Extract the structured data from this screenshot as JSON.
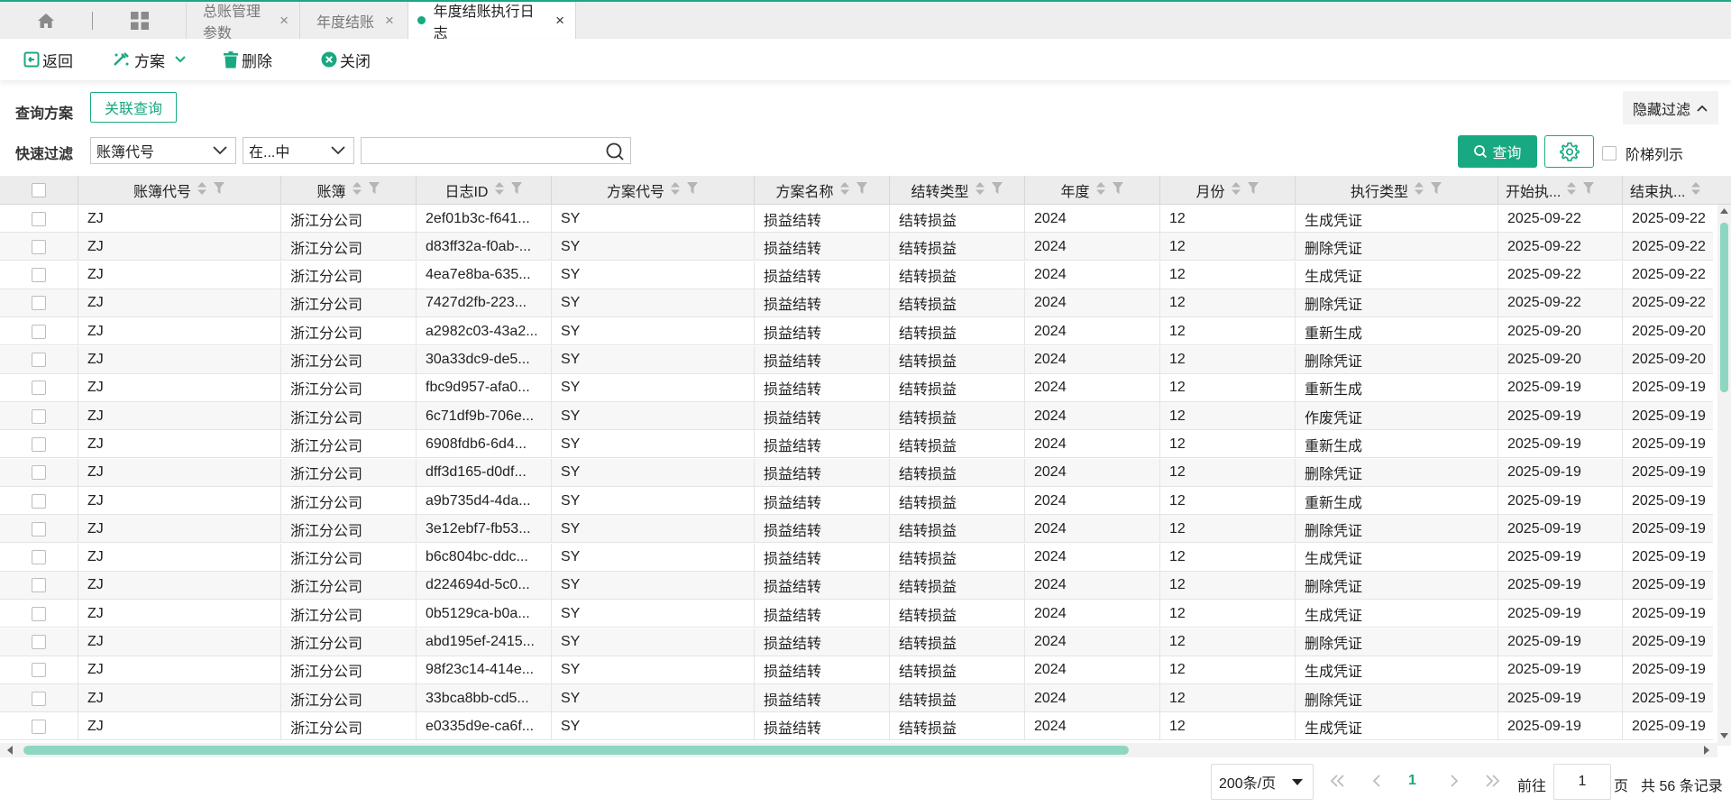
{
  "tabs": [
    {
      "label": "总账管理参数",
      "active": false
    },
    {
      "label": "年度结账",
      "active": false
    },
    {
      "label": "年度结账执行日志",
      "active": true
    }
  ],
  "toolbar": {
    "back_label": "返回",
    "scheme_label": "方案",
    "delete_label": "删除",
    "close_label": "关闭"
  },
  "filters": {
    "query_scheme_label": "查询方案",
    "assoc_query_label": "关联查询",
    "hide_filter_label": "隐藏过滤",
    "quick_filter_label": "快速过滤",
    "field_select": "账簿代号",
    "operator_select": "在...中",
    "search_value": "",
    "query_button": "查询",
    "ladder_label": "阶梯列示"
  },
  "colors": {
    "accent": "#18a982",
    "scroll_thumb": "#8fd6c2"
  },
  "table": {
    "columns": [
      "账簿代号",
      "账簿",
      "日志ID",
      "方案代号",
      "方案名称",
      "结转类型",
      "年度",
      "月份",
      "执行类型",
      "开始执...",
      "结束执..."
    ],
    "rows": [
      [
        "ZJ",
        "浙江分公司",
        "2ef01b3c-f641...",
        "SY",
        "损益结转",
        "结转损益",
        "2024",
        "12",
        "生成凭证",
        "2025-09-22",
        "2025-09-22"
      ],
      [
        "ZJ",
        "浙江分公司",
        "d83ff32a-f0ab-...",
        "SY",
        "损益结转",
        "结转损益",
        "2024",
        "12",
        "删除凭证",
        "2025-09-22",
        "2025-09-22"
      ],
      [
        "ZJ",
        "浙江分公司",
        "4ea7e8ba-635...",
        "SY",
        "损益结转",
        "结转损益",
        "2024",
        "12",
        "生成凭证",
        "2025-09-22",
        "2025-09-22"
      ],
      [
        "ZJ",
        "浙江分公司",
        "7427d2fb-223...",
        "SY",
        "损益结转",
        "结转损益",
        "2024",
        "12",
        "删除凭证",
        "2025-09-22",
        "2025-09-22"
      ],
      [
        "ZJ",
        "浙江分公司",
        "a2982c03-43a2...",
        "SY",
        "损益结转",
        "结转损益",
        "2024",
        "12",
        "重新生成",
        "2025-09-20",
        "2025-09-20"
      ],
      [
        "ZJ",
        "浙江分公司",
        "30a33dc9-de5...",
        "SY",
        "损益结转",
        "结转损益",
        "2024",
        "12",
        "删除凭证",
        "2025-09-20",
        "2025-09-20"
      ],
      [
        "ZJ",
        "浙江分公司",
        "fbc9d957-afa0...",
        "SY",
        "损益结转",
        "结转损益",
        "2024",
        "12",
        "重新生成",
        "2025-09-19",
        "2025-09-19"
      ],
      [
        "ZJ",
        "浙江分公司",
        "6c71df9b-706e...",
        "SY",
        "损益结转",
        "结转损益",
        "2024",
        "12",
        "作废凭证",
        "2025-09-19",
        "2025-09-19"
      ],
      [
        "ZJ",
        "浙江分公司",
        "6908fdb6-6d4...",
        "SY",
        "损益结转",
        "结转损益",
        "2024",
        "12",
        "重新生成",
        "2025-09-19",
        "2025-09-19"
      ],
      [
        "ZJ",
        "浙江分公司",
        "dff3d165-d0df...",
        "SY",
        "损益结转",
        "结转损益",
        "2024",
        "12",
        "删除凭证",
        "2025-09-19",
        "2025-09-19"
      ],
      [
        "ZJ",
        "浙江分公司",
        "a9b735d4-4da...",
        "SY",
        "损益结转",
        "结转损益",
        "2024",
        "12",
        "重新生成",
        "2025-09-19",
        "2025-09-19"
      ],
      [
        "ZJ",
        "浙江分公司",
        "3e12ebf7-fb53...",
        "SY",
        "损益结转",
        "结转损益",
        "2024",
        "12",
        "删除凭证",
        "2025-09-19",
        "2025-09-19"
      ],
      [
        "ZJ",
        "浙江分公司",
        "b6c804bc-ddc...",
        "SY",
        "损益结转",
        "结转损益",
        "2024",
        "12",
        "生成凭证",
        "2025-09-19",
        "2025-09-19"
      ],
      [
        "ZJ",
        "浙江分公司",
        "d224694d-5c0...",
        "SY",
        "损益结转",
        "结转损益",
        "2024",
        "12",
        "删除凭证",
        "2025-09-19",
        "2025-09-19"
      ],
      [
        "ZJ",
        "浙江分公司",
        "0b5129ca-b0a...",
        "SY",
        "损益结转",
        "结转损益",
        "2024",
        "12",
        "生成凭证",
        "2025-09-19",
        "2025-09-19"
      ],
      [
        "ZJ",
        "浙江分公司",
        "abd195ef-2415...",
        "SY",
        "损益结转",
        "结转损益",
        "2024",
        "12",
        "删除凭证",
        "2025-09-19",
        "2025-09-19"
      ],
      [
        "ZJ",
        "浙江分公司",
        "98f23c14-414e...",
        "SY",
        "损益结转",
        "结转损益",
        "2024",
        "12",
        "生成凭证",
        "2025-09-19",
        "2025-09-19"
      ],
      [
        "ZJ",
        "浙江分公司",
        "33bca8bb-cd5...",
        "SY",
        "损益结转",
        "结转损益",
        "2024",
        "12",
        "删除凭证",
        "2025-09-19",
        "2025-09-19"
      ],
      [
        "ZJ",
        "浙江分公司",
        "e0335d9e-ca6f...",
        "SY",
        "损益结转",
        "结转损益",
        "2024",
        "12",
        "生成凭证",
        "2025-09-19",
        "2025-09-19"
      ]
    ]
  },
  "pagination": {
    "page_size": "200条/页",
    "current_page": "1",
    "goto_label": "前往",
    "goto_value": "1",
    "page_suffix": "页",
    "total": "共 56 条记录"
  }
}
